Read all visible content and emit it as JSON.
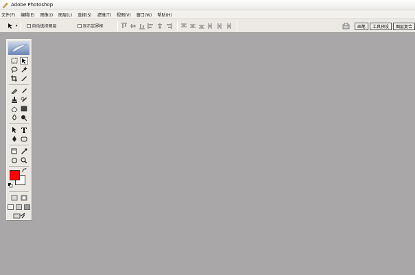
{
  "window": {
    "title": "Adobe Photoshop"
  },
  "menu": [
    "文件(F)",
    "编辑(E)",
    "图像(I)",
    "图层(L)",
    "选择(S)",
    "滤镜(T)",
    "视图(V)",
    "窗口(W)",
    "帮助(H)"
  ],
  "options": {
    "auto_select_layer": "自动选择图层",
    "show_bounding_box": "显示定界框"
  },
  "palette_well": {
    "tabs": [
      "画笔",
      "工具预设",
      "图层复合"
    ]
  },
  "colors": {
    "foreground": "#ff0000",
    "background": "#ffffff",
    "canvas": "#a9a7a8"
  }
}
